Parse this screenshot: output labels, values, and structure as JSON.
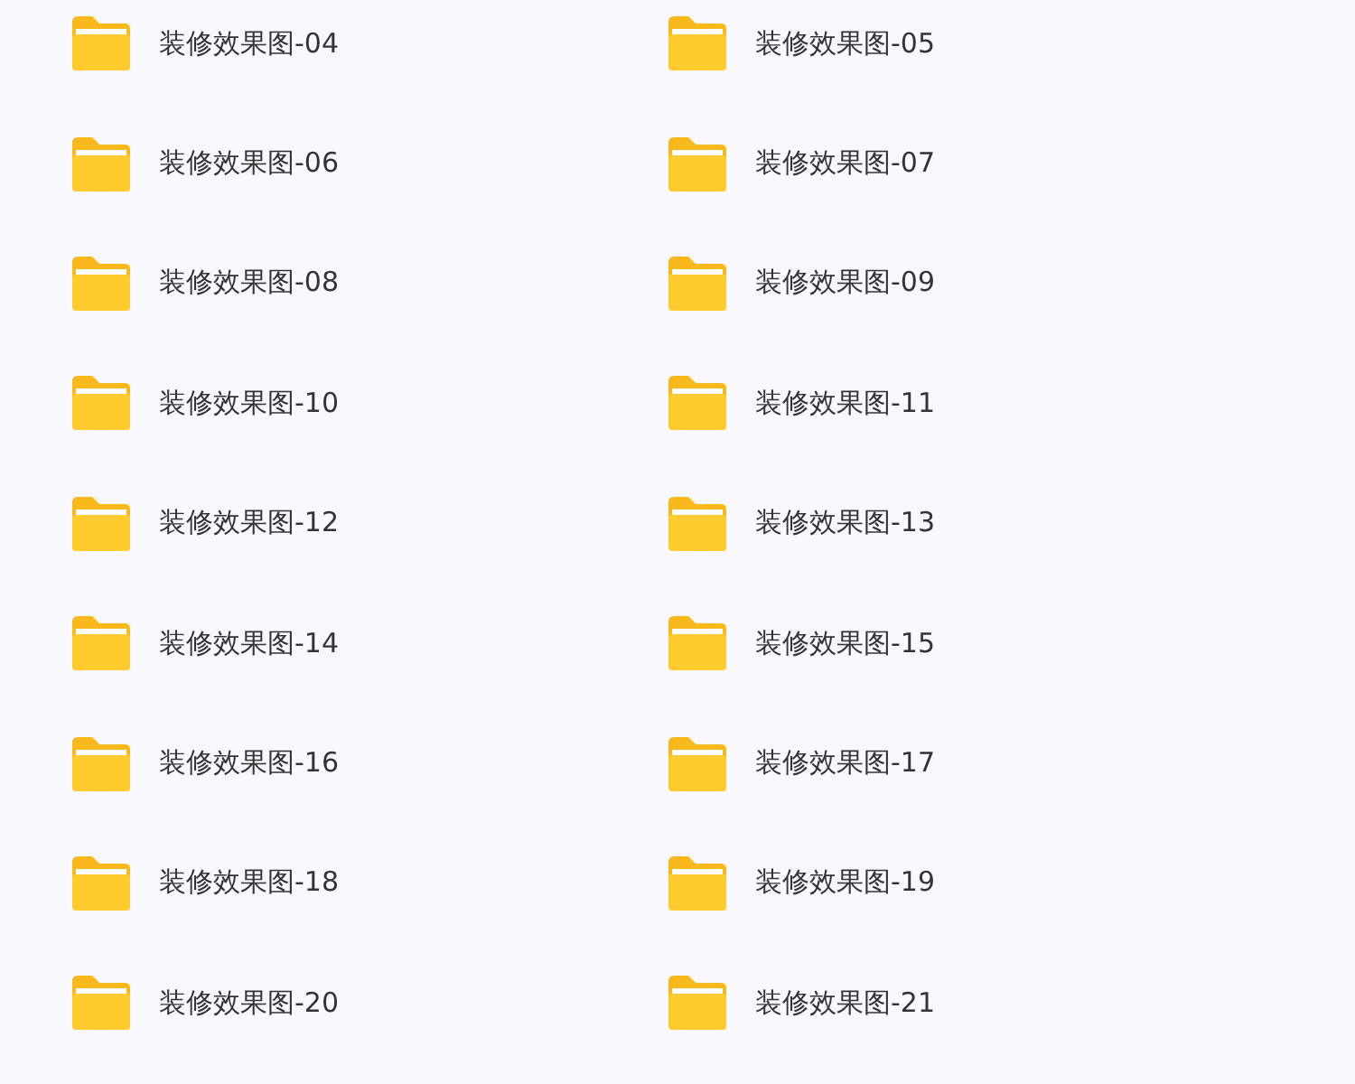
{
  "folders": [
    {
      "name": "装修效果图-04"
    },
    {
      "name": "装修效果图-05"
    },
    {
      "name": "装修效果图-06"
    },
    {
      "name": "装修效果图-07"
    },
    {
      "name": "装修效果图-08"
    },
    {
      "name": "装修效果图-09"
    },
    {
      "name": "装修效果图-10"
    },
    {
      "name": "装修效果图-11"
    },
    {
      "name": "装修效果图-12"
    },
    {
      "name": "装修效果图-13"
    },
    {
      "name": "装修效果图-14"
    },
    {
      "name": "装修效果图-15"
    },
    {
      "name": "装修效果图-16"
    },
    {
      "name": "装修效果图-17"
    },
    {
      "name": "装修效果图-18"
    },
    {
      "name": "装修效果图-19"
    },
    {
      "name": "装修效果图-20"
    },
    {
      "name": "装修效果图-21"
    }
  ]
}
